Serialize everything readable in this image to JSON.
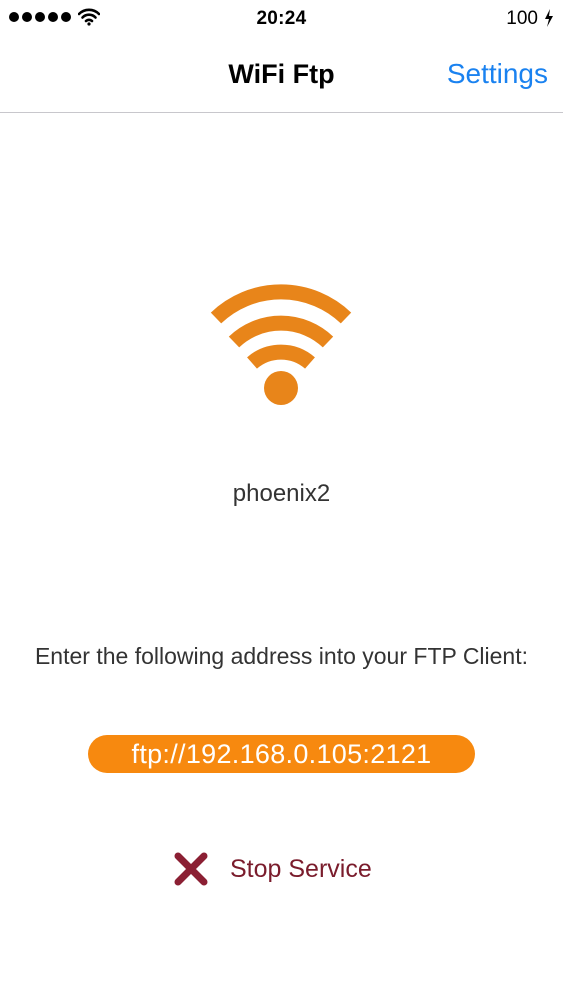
{
  "status_bar": {
    "signal_icon": "signal-dots-icon",
    "wifi_icon": "wifi-icon",
    "time": "20:24",
    "battery": "100",
    "charging_icon": "bolt-icon"
  },
  "nav": {
    "title": "WiFi Ftp",
    "settings_label": "Settings"
  },
  "main": {
    "wifi_icon": "wifi-icon",
    "network_name": "phoenix2",
    "instructions": "Enter the following address into your FTP Client:",
    "ftp_address": "ftp://192.168.0.105:2121",
    "stop_icon": "close-x-icon",
    "stop_label": "Stop Service"
  },
  "colors": {
    "accent": "#f7890f",
    "link": "#1a82f0",
    "stop": "#7a1c2c"
  }
}
